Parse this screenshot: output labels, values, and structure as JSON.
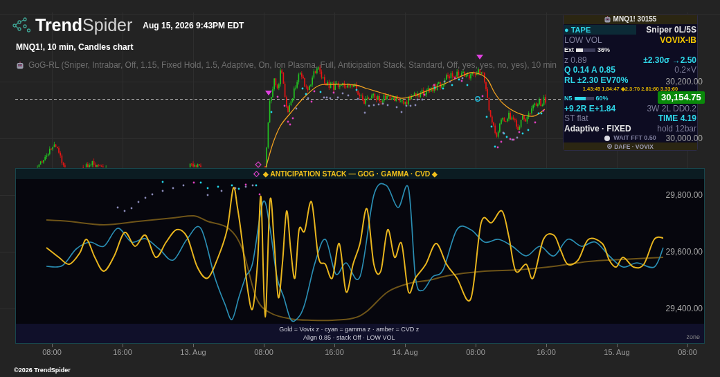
{
  "header": {
    "logo": "**Trend**Spider",
    "datetime": "Aug 15, 2026 9:43PM EDT"
  },
  "chart_title": "MNQ1!, 10 min, Candles chart",
  "indicator_legend": "GoG-RL (Sniper, Intrabar, Off, 1.15, Fixed Hold, 1.5, Adaptive, On, Ion Plasma, Full, Anticipation Stack, Standard, Off, yes, yes, no, yes), 10 min",
  "info_panel": {
    "title": "MNQ1! 30155",
    "rows": [
      {
        "kind": "pair",
        "left": {
          "text": "● TAPE",
          "kind": "signal",
          "highlighted": true
        },
        "right": {
          "text": "Sniper 0L/5S",
          "kind": "strong"
        }
      },
      {
        "kind": "pair",
        "left": {
          "text": "LOW VOL",
          "kind": "muted",
          "highlighted": false
        },
        "right": {
          "text": "VOVIX-IB",
          "kind": "alert"
        }
      },
      {
        "kind": "meter",
        "label": {
          "text": "Ext",
          "kind": "strong"
        },
        "level": 0.36,
        "reading": "36%"
      },
      {
        "kind": "pair",
        "left": {
          "text": "z 0.89",
          "kind": "muted",
          "highlighted": false
        },
        "right": {
          "text": "±2.30σ →2.50",
          "kind": "signal"
        }
      },
      {
        "kind": "pair",
        "left": {
          "text": "Q 0.14 A 0.85",
          "kind": "signal",
          "highlighted": false
        },
        "right": {
          "text": "0.2×V",
          "kind": "muted"
        }
      },
      {
        "kind": "pair",
        "left": {
          "text": "RL ±2.30 EV70%",
          "kind": "signal",
          "highlighted": false
        }
      },
      {
        "kind": "scale",
        "text": "1.43:45 1.84:47 ◆2.3:70 2.81:60 3.33:60"
      },
      {
        "kind": "meter",
        "label": {
          "text": "N5",
          "kind": "signal"
        },
        "level": 0.6,
        "reading": "60%"
      },
      {
        "kind": "pair",
        "left": {
          "text": "+9.2R E+1.84",
          "kind": "signal",
          "highlighted": false
        },
        "right": {
          "text": "3W 2L DD0.2",
          "kind": "muted"
        }
      },
      {
        "kind": "pair",
        "left": {
          "text": "ST flat",
          "kind": "muted",
          "highlighted": false
        },
        "right": {
          "text": "TIME 4.19",
          "kind": "signal"
        }
      },
      {
        "kind": "pair",
        "left": {
          "text": "Adaptive · FIXED",
          "kind": "strong",
          "highlighted": false
        },
        "right": {
          "text": "hold 12bar",
          "kind": "muted"
        }
      },
      {
        "kind": "status",
        "text": "WAIT FFT 0.50"
      }
    ],
    "footer": "DAFE · VOVIX"
  },
  "stack_panel": {
    "title": "◆ ANTICIPATION STACK — GOG · GAMMA · CVD ◆",
    "legend": [
      "Gold = Vovix z · cyan = gamma z · amber = CVD z",
      "Align 0.85 · stack Off · LOW VOL"
    ],
    "edge_label": "zone"
  },
  "price_axis": {
    "labels": [
      "30,200.00",
      "30,000.00",
      "29,800.00",
      "29,600.00",
      "29,400.00"
    ],
    "current_price": "30,154.75"
  },
  "time_axis": {
    "labels": [
      "08:00",
      "16:00",
      "13. Aug",
      "08:00",
      "16:00",
      "14. Aug",
      "08:00",
      "16:00",
      "15. Aug",
      "08:00"
    ]
  },
  "copyright": "©2026 TrendSpider"
}
